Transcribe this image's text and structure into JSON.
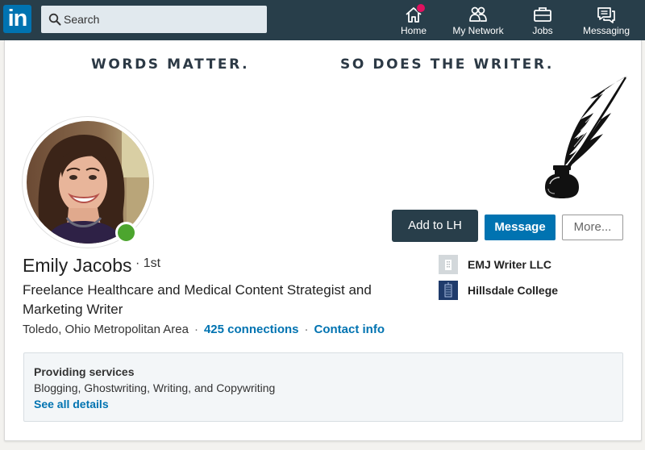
{
  "nav": {
    "logo_text": "in",
    "search_placeholder": "Search",
    "items": [
      {
        "label": "Home",
        "icon": "home-icon",
        "has_badge": true
      },
      {
        "label": "My Network",
        "icon": "network-icon"
      },
      {
        "label": "Jobs",
        "icon": "briefcase-icon"
      },
      {
        "label": "Messaging",
        "icon": "messaging-icon"
      }
    ]
  },
  "banner": {
    "left_text": "WORDS MATTER.",
    "right_text": "SO DOES THE WRITER.",
    "graphic": "quill-and-inkwell"
  },
  "profile": {
    "name": "Emily Jacobs",
    "degree": "· 1st",
    "headline": "Freelance Healthcare and Medical Content Strategist and Marketing Writer",
    "location": "Toledo, Ohio Metropolitan Area",
    "connections": "425 connections",
    "contact_info": "Contact info",
    "online": true
  },
  "actions": {
    "add_label": "Add to LH",
    "message_label": "Message",
    "more_label": "More..."
  },
  "experience": [
    {
      "label": "EMJ Writer LLC",
      "icon": "company-icon"
    },
    {
      "label": "Hillsdale College",
      "icon": "school-icon"
    }
  ],
  "services": {
    "title": "Providing services",
    "list": "Blogging, Ghostwriting, Writing, and Copywriting",
    "link": "See all details"
  },
  "colors": {
    "nav_bg": "#283e4a",
    "brand_blue": "#0073b1",
    "online_green": "#4ca52e",
    "badge_red": "#e0115f"
  }
}
